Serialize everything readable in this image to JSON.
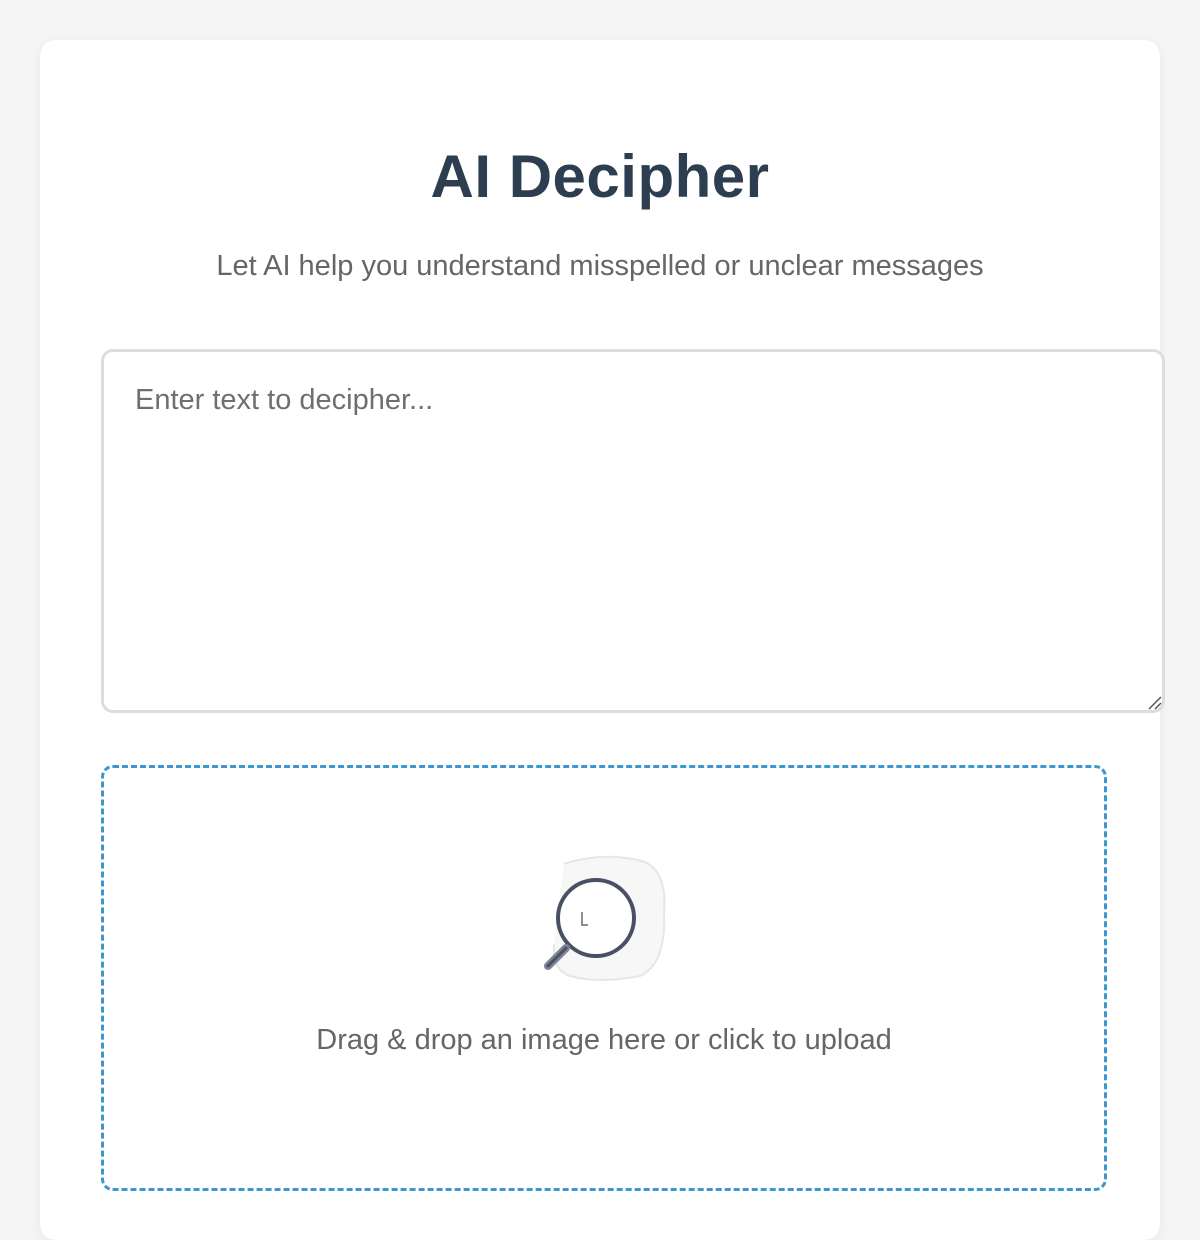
{
  "header": {
    "title": "AI Decipher",
    "subtitle": "Let AI help you understand misspelled or unclear messages"
  },
  "input": {
    "value": "",
    "placeholder": "Enter text to decipher..."
  },
  "upload": {
    "icon": "magnifier-icon",
    "label": "Drag & drop an image here or click to upload"
  },
  "colors": {
    "title": "#2c3e50",
    "subtitle": "#666666",
    "dropzone_border": "#3d97cf",
    "background": "#f5f5f5"
  }
}
